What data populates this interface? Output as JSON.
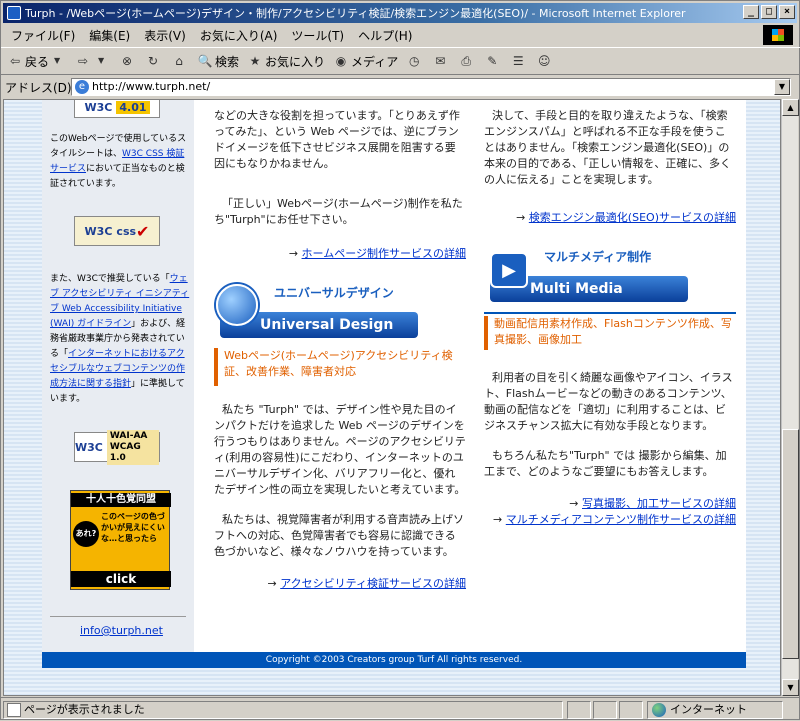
{
  "window": {
    "title": "Turph - /Webページ(ホームページ)デザイン・制作/アクセシビリティ検証/検索エンジン最適化(SEO)/ - Microsoft Internet Explorer",
    "min": "_",
    "max": "□",
    "close": "×"
  },
  "menu": [
    "ファイル(F)",
    "編集(E)",
    "表示(V)",
    "お気に入り(A)",
    "ツール(T)",
    "ヘルプ(H)"
  ],
  "toolbar": {
    "back": "戻る",
    "search": "検索",
    "favorites": "お気に入り",
    "media": "メディア"
  },
  "address": {
    "label": "アドレス(D)",
    "url": "http://www.turph.net/"
  },
  "sidebar": {
    "badge_html": "4.01",
    "text1_a": "このWebページで使用しているスタイルシートは、",
    "text1_link": "W3C CSS 検証サービス",
    "text1_b": "において正当なものと検証されています。",
    "badge_css": "css",
    "text2_a": "また、W3Cで推奨している「",
    "text2_link1": "ウェブ アクセシビリティ イニシアティブ Web Accessibility Initiative (WAI) ガイドライン",
    "text2_b": "」および、経務省厳政事業庁から発表されている「",
    "text2_link2": "インターネットにおけるアクセシブルなウェブコンテンツの作成方法に関する指針",
    "text2_c": "」に準拠しています。",
    "badge_wai": "WAI-AA",
    "badge_wcag": "WCAG 1.0",
    "promo_title": "十人十色覚同盟",
    "promo_lead": "あれ?",
    "promo_body": "このページの色づかいが見えにくいな…と思ったら",
    "promo_click": "click",
    "email": "info@turph.net"
  },
  "col1": {
    "p1": "などの大きな役割を担っています。「とりあえず作ってみた」、という Web ページでは、逆にブランドイメージを低下させビジネス展開を阻害する要因にもなりかねません。",
    "p2": "「正しい」Webページ(ホームページ)制作を私たち\"Turph\"にお任せ下さい。",
    "link1": "ホームページ制作サービスの詳細",
    "banner_title": "ユニバーサルデザイン",
    "banner_band": "Universal Design",
    "heading": "Webページ(ホームページ)アクセシビリティ検証、改善作業、障害者対応",
    "p3": "私たち \"Turph\" では、デザイン性や見た目のインパクトだけを追求した Web ページのデザインを行うつもりはありません。ページのアクセシビリティ(利用の容易性)にこだわり、インターネットのユニバーサルデザイン化、バリアフリー化と、優れたデザイン性の両立を実現したいと考えています。",
    "p4": "私たちは、視覚障害者が利用する音声読み上げソフトへの対応、色覚障害者でも容易に認識できる色づかいなど、様々なノウハウを持っています。",
    "link2": "アクセシビリティ検証サービスの詳細"
  },
  "col2": {
    "p1": "決して、手段と目的を取り違えたような、「検索エンジンスパム」と呼ばれる不正な手段を使うことはありません。「検索エンジン最適化(SEO)」の本来の目的である、「正しい情報を、正確に、多くの人に伝える」ことを実現します。",
    "link1": "検索エンジン最適化(SEO)サービスの詳細",
    "banner_title": "マルチメディア制作",
    "banner_band": "Multi Media",
    "heading": "動画配信用素材作成、Flashコンテンツ作成、写真撮影、画像加工",
    "p2": "利用者の目を引く綺麗な画像やアイコン、イラスト、Flashムービーなどの動きのあるコンテンツ、動画の配信などを「適切」に利用することは、ビジネスチャンス拡大に有効な手段となります。",
    "p3": "もちろん私たち\"Turph\" では 撮影から編集、加工まで、どのようなご要望にもお答えします。",
    "link2": "写真撮影、加工サービスの詳細",
    "link3": "マルチメディアコンテンツ制作サービスの詳細"
  },
  "footer": "Copyright ©2003 Creators group Turf All rights reserved.",
  "status": {
    "text": "ページが表示されました",
    "zone": "インターネット"
  },
  "arrow": "→"
}
